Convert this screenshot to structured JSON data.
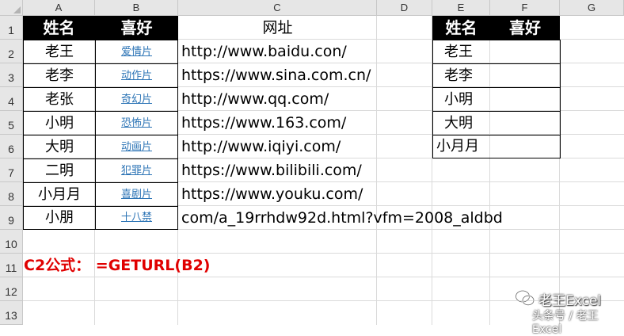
{
  "columns": [
    "A",
    "B",
    "C",
    "D",
    "E",
    "F",
    "G"
  ],
  "rows": [
    "1",
    "2",
    "3",
    "4",
    "5",
    "6",
    "7",
    "8",
    "9",
    "10",
    "11",
    "12",
    "13"
  ],
  "table1": {
    "header_name": "姓名",
    "header_fav": "喜好",
    "rows": [
      {
        "name": "老王",
        "fav": "爱情片"
      },
      {
        "name": "老李",
        "fav": "动作片"
      },
      {
        "name": "老张",
        "fav": "奇幻片"
      },
      {
        "name": "小明",
        "fav": "恐怖片"
      },
      {
        "name": "大明",
        "fav": "动画片"
      },
      {
        "name": "二明",
        "fav": "犯罪片"
      },
      {
        "name": "小月月",
        "fav": "喜剧片"
      },
      {
        "name": "小朋",
        "fav": "十八禁"
      }
    ]
  },
  "url_column": {
    "header": "网址",
    "values": [
      "http://www.baidu.con/",
      "https://www.sina.com.cn/",
      "http://www.qq.com/",
      "https://www.163.com/",
      "http://www.iqiyi.com/",
      "https://www.bilibili.com/",
      "https://www.youku.com/",
      "com/a_19rrhdw92d.html?vfm=2008_aldbd"
    ]
  },
  "table2": {
    "header_name": "姓名",
    "header_fav": "喜好",
    "names": [
      "老王",
      "老李",
      "小明",
      "大明",
      "小月月"
    ]
  },
  "formula_note": "C2公式：  =GETURL(B2)",
  "watermark": {
    "name": "老王Excel",
    "line": "头条号 / 老王Excel"
  },
  "colors": {
    "header_bg": "#000000",
    "header_text": "#ffffff",
    "link": "#2e75b6",
    "formula": "#e00000",
    "grid": "#dadada",
    "headings_bg": "#e6e6e6"
  }
}
